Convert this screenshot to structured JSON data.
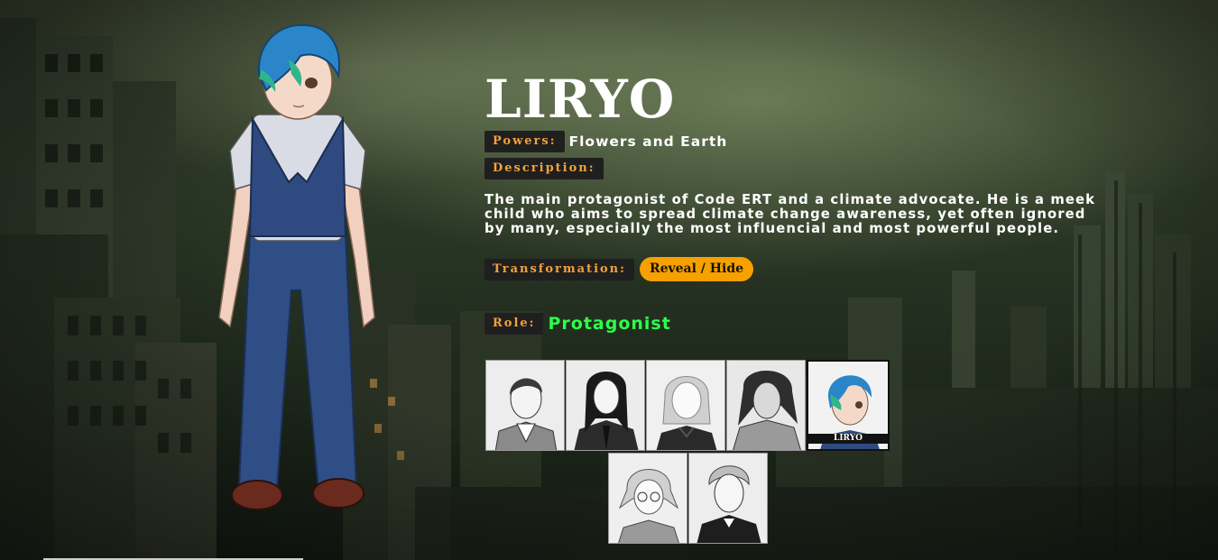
{
  "character": {
    "name": "LIRYO",
    "powers_label": "Powers:",
    "powers": "Flowers and Earth",
    "description_label": "Description:",
    "description": "The main protagonist of Code ERT and a climate advocate. He is a meek child who aims to spread climate change awareness, yet often ignored by many, especially the most influencial and most powerful people.",
    "transformation_label": "Transformation:",
    "reveal_label": "Reveal / Hide",
    "role_label": "Role:",
    "role": "Protagonist"
  },
  "gallery": {
    "active_caption": "LIRYO"
  },
  "colors": {
    "label_text": "#f2a23a",
    "label_bg": "#201f1f",
    "reveal_bg": "#f6a100",
    "role_green": "#2cff4a"
  }
}
